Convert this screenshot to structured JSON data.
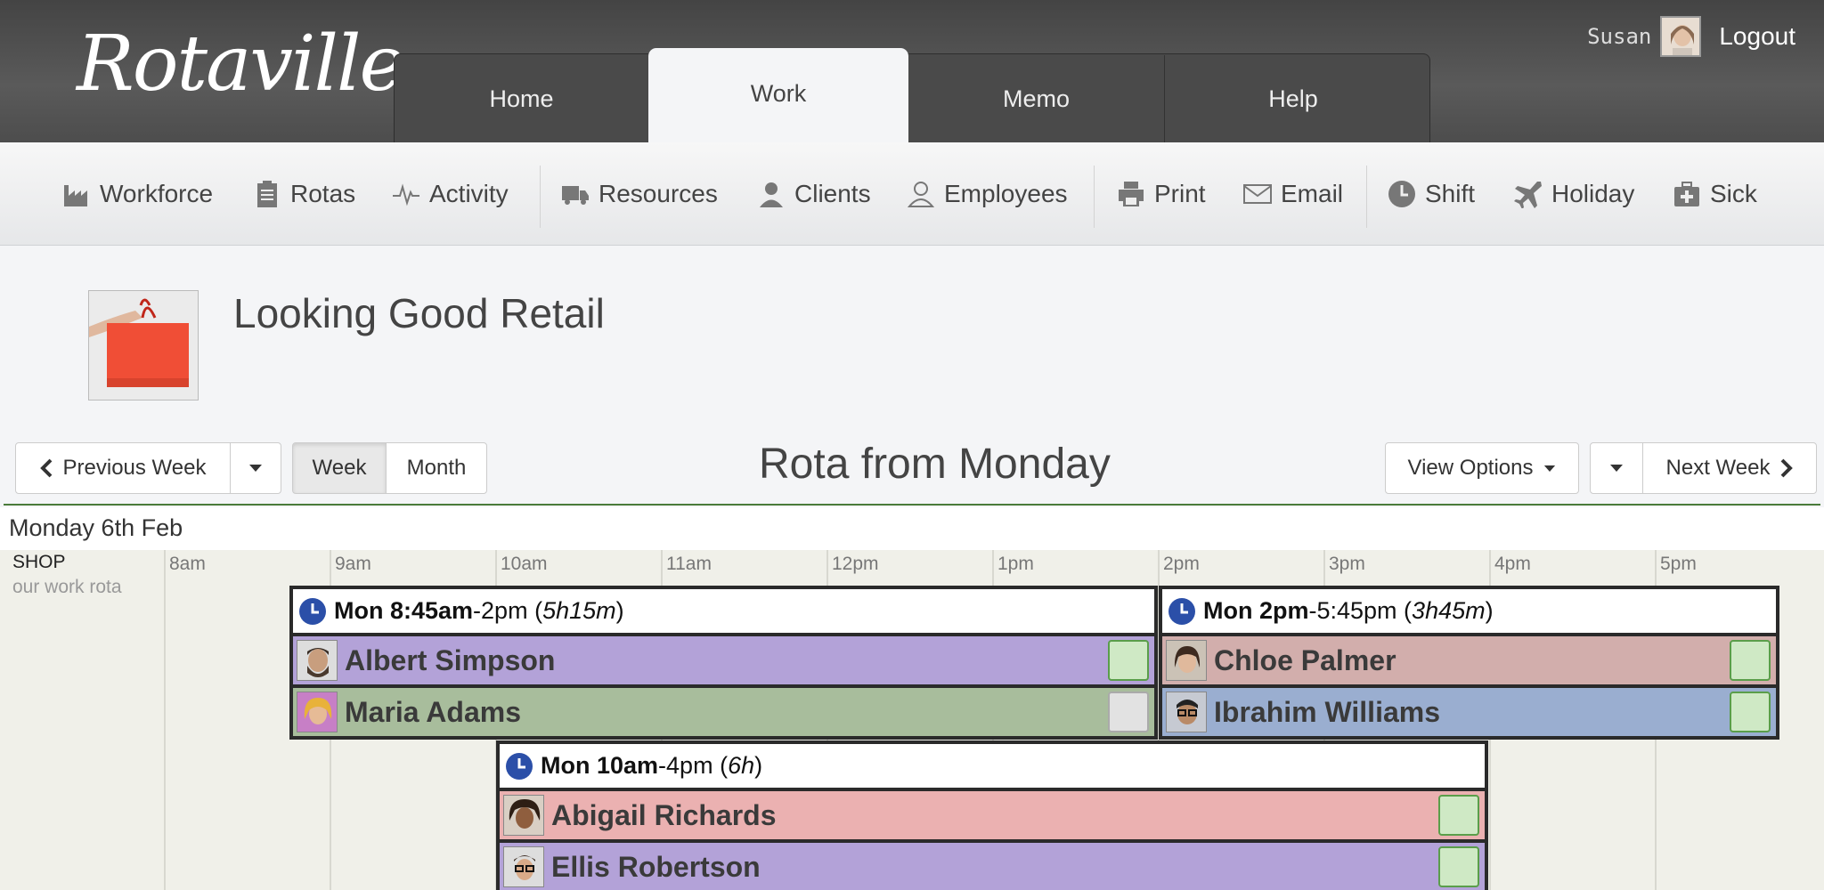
{
  "app": {
    "logo": "Rotaville"
  },
  "nav_tabs": [
    "Home",
    "Work",
    "Memo",
    "Help"
  ],
  "user": {
    "name": "Susan",
    "logout": "Logout"
  },
  "toolbar": [
    {
      "label": "Workforce",
      "icon": "factory-icon"
    },
    {
      "label": "Rotas",
      "icon": "clipboard-icon"
    },
    {
      "label": "Activity",
      "icon": "pulse-icon"
    },
    {
      "label": "Resources",
      "icon": "truck-icon"
    },
    {
      "label": "Clients",
      "icon": "client-icon"
    },
    {
      "label": "Employees",
      "icon": "person-icon"
    },
    {
      "label": "Print",
      "icon": "printer-icon"
    },
    {
      "label": "Email",
      "icon": "envelope-icon"
    },
    {
      "label": "Shift",
      "icon": "clock-icon"
    },
    {
      "label": "Holiday",
      "icon": "plane-icon"
    },
    {
      "label": "Sick",
      "icon": "medical-kit-icon"
    }
  ],
  "company": {
    "name": "Looking Good Retail"
  },
  "nav": {
    "prev": "Previous Week",
    "week": "Week",
    "month": "Month",
    "title": "Rota from Monday",
    "view_options": "View Options",
    "next": "Next Week"
  },
  "day": "Monday 6th Feb",
  "hours": [
    "8am",
    "9am",
    "10am",
    "11am",
    "12pm",
    "1pm",
    "2pm",
    "3pm",
    "4pm",
    "5pm"
  ],
  "location": {
    "name": "SHOP",
    "sub": "our work rota"
  },
  "shifts": [
    {
      "start_bold": "Mon 8:45am",
      "end": "-2pm (",
      "duration": "5h15m",
      "close": ")",
      "employees": [
        {
          "name": "Albert Simpson",
          "color": "#b3a2d8",
          "checked_style": "green"
        },
        {
          "name": "Maria Adams",
          "color": "#a8bd9c",
          "checked_style": "grey"
        }
      ]
    },
    {
      "start_bold": "Mon 2pm",
      "end": "-5:45pm (",
      "duration": "3h45m",
      "close": ")",
      "employees": [
        {
          "name": "Chloe Palmer",
          "color": "#d2aeac",
          "checked_style": "green"
        },
        {
          "name": "Ibrahim Williams",
          "color": "#9aaed0",
          "checked_style": "green"
        }
      ]
    },
    {
      "start_bold": "Mon 10am",
      "end": "-4pm (",
      "duration": "6h",
      "close": ")",
      "employees": [
        {
          "name": "Abigail Richards",
          "color": "#ebb1b1",
          "checked_style": "green"
        },
        {
          "name": "Ellis Robertson",
          "color": "#b3a2d8",
          "checked_style": "green"
        }
      ]
    }
  ]
}
